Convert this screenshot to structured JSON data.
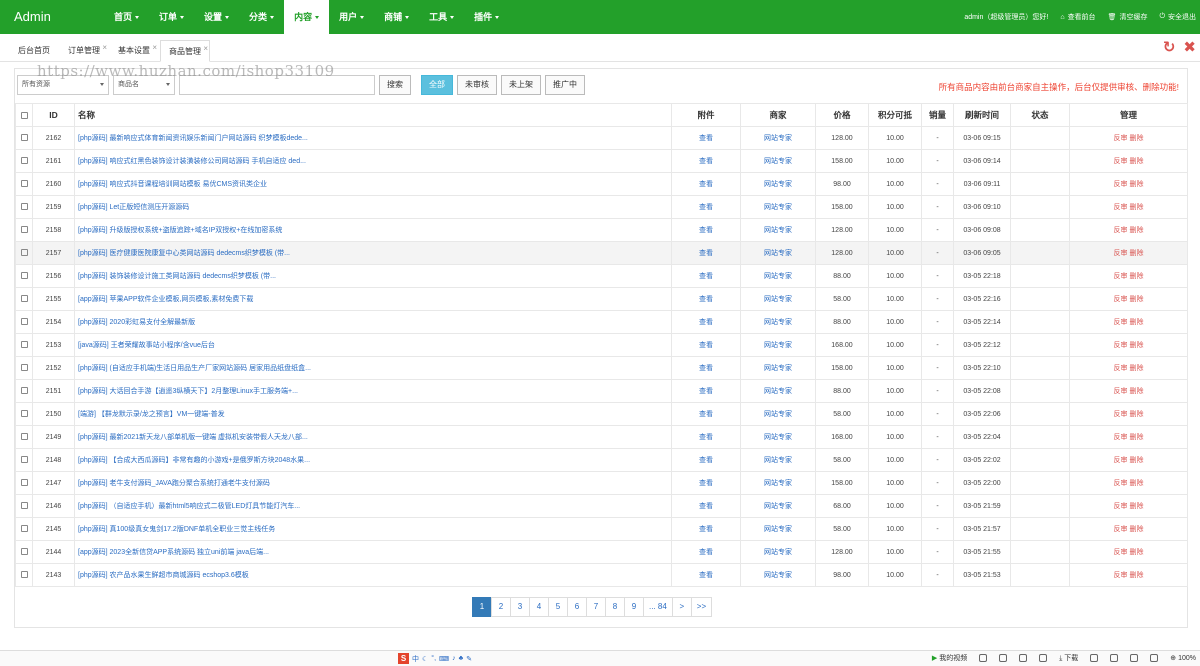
{
  "brand": "Admin",
  "nav": [
    {
      "label": "首页",
      "active": false
    },
    {
      "label": "订单",
      "active": false
    },
    {
      "label": "设置",
      "active": false
    },
    {
      "label": "分类",
      "active": false
    },
    {
      "label": "内容",
      "active": true
    },
    {
      "label": "用户",
      "active": false
    },
    {
      "label": "商铺",
      "active": false
    },
    {
      "label": "工具",
      "active": false
    },
    {
      "label": "插件",
      "active": false
    }
  ],
  "topright": {
    "user": "admin（超级管理员）您好!",
    "view_front": "查看前台",
    "clear_cache": "清空缓存",
    "logout": "安全退出"
  },
  "tabs": [
    {
      "label": "后台首页",
      "close": "",
      "active": false
    },
    {
      "label": "订单管理",
      "close": "×",
      "active": false
    },
    {
      "label": "基本设置",
      "close": "×",
      "active": false
    },
    {
      "label": "商品管理",
      "close": "×",
      "active": true
    }
  ],
  "tab_tools": {
    "refresh": "↻",
    "close": "✖"
  },
  "colors": {
    "brand": "#23a02a",
    "link": "#2a6cc2",
    "danger": "#e43",
    "info": "#5bc0de",
    "pager": "#337ab7"
  },
  "watermark": "https://www.huzhan.com/ishop33109",
  "filters": {
    "source": "所有资源",
    "field": "商品名",
    "search": "搜索",
    "btn_all": "全部",
    "btn_unreviewed": "未审核",
    "btn_offline": "未上架",
    "btn_promoting": "推广中"
  },
  "notice": "所有商品内容由前台商家自主操作，后台仅提供审核、删除功能!",
  "columns": [
    "ID",
    "名称",
    "附件",
    "商家",
    "价格",
    "积分可抵",
    "销量",
    "刷新时间",
    "状态",
    "管理"
  ],
  "rows": [
    {
      "id": "2162",
      "name": "[php源码] 最新响应式体育新闻资讯娱乐新闻门户网站源码 织梦模板dede...",
      "attach": "查看",
      "merchant": "网站专家",
      "price": "128.00",
      "points": "10.00",
      "sales": "-",
      "time": "03-06 09:15",
      "status": "",
      "unreview": "反审",
      "del": "删除"
    },
    {
      "id": "2161",
      "name": "[php源码] 响应式红黑色装饰设计装潢装修公司网站源码 手机自适应 ded...",
      "attach": "查看",
      "merchant": "网站专家",
      "price": "158.00",
      "points": "10.00",
      "sales": "-",
      "time": "03-06 09:14",
      "status": "",
      "unreview": "反审",
      "del": "删除"
    },
    {
      "id": "2160",
      "name": "[php源码] 响应式抖音课程培训网站模板 易优CMS资讯类企业",
      "attach": "查看",
      "merchant": "网站专家",
      "price": "98.00",
      "points": "10.00",
      "sales": "-",
      "time": "03-06 09:11",
      "status": "",
      "unreview": "反审",
      "del": "删除"
    },
    {
      "id": "2159",
      "name": "[php源码] Let正版短信测压开源源码",
      "attach": "查看",
      "merchant": "网站专家",
      "price": "158.00",
      "points": "10.00",
      "sales": "-",
      "time": "03-06 09:10",
      "status": "",
      "unreview": "反审",
      "del": "删除"
    },
    {
      "id": "2158",
      "name": "[php源码] 升级版授权系统+盗版追踪+域名IP双授权+在线加密系统",
      "attach": "查看",
      "merchant": "网站专家",
      "price": "128.00",
      "points": "10.00",
      "sales": "-",
      "time": "03-06 09:08",
      "status": "",
      "unreview": "反审",
      "del": "删除"
    },
    {
      "id": "2157",
      "name": "[php源码] 医疗健康医院康复中心类网站源码 dedecms织梦模板 (带...",
      "attach": "查看",
      "merchant": "网站专家",
      "price": "128.00",
      "points": "10.00",
      "sales": "-",
      "time": "03-06 09:05",
      "status": "",
      "unreview": "反审",
      "del": "删除",
      "hl": true
    },
    {
      "id": "2156",
      "name": "[php源码] 装饰装修设计施工类网站源码 dedecms织梦模板 (带...",
      "attach": "查看",
      "merchant": "网站专家",
      "price": "88.00",
      "points": "10.00",
      "sales": "-",
      "time": "03-05 22:18",
      "status": "",
      "unreview": "反审",
      "del": "删除"
    },
    {
      "id": "2155",
      "name": "[app源码] 苹果APP软件企业模板,网页模板,素材免费下载",
      "attach": "查看",
      "merchant": "网站专家",
      "price": "58.00",
      "points": "10.00",
      "sales": "-",
      "time": "03-05 22:16",
      "status": "",
      "unreview": "反审",
      "del": "删除"
    },
    {
      "id": "2154",
      "name": "[php源码] 2020彩虹易支付全解最新版",
      "attach": "查看",
      "merchant": "网站专家",
      "price": "88.00",
      "points": "10.00",
      "sales": "-",
      "time": "03-05 22:14",
      "status": "",
      "unreview": "反审",
      "del": "删除"
    },
    {
      "id": "2153",
      "name": "[java源码] 王者荣耀故事站小程序/含vue后台",
      "attach": "查看",
      "merchant": "网站专家",
      "price": "168.00",
      "points": "10.00",
      "sales": "-",
      "time": "03-05 22:12",
      "status": "",
      "unreview": "反审",
      "del": "删除"
    },
    {
      "id": "2152",
      "name": "[php源码] (自适应手机端)生活日用品生产厂家网站源码 居家用品纸盘纸盒...",
      "attach": "查看",
      "merchant": "网站专家",
      "price": "158.00",
      "points": "10.00",
      "sales": "-",
      "time": "03-05 22:10",
      "status": "",
      "unreview": "反审",
      "del": "删除"
    },
    {
      "id": "2151",
      "name": "[php源码] 大话回合手游【逍遥3纵横天下】2月整理Linux手工服务端+...",
      "attach": "查看",
      "merchant": "网站专家",
      "price": "88.00",
      "points": "10.00",
      "sales": "-",
      "time": "03-05 22:08",
      "status": "",
      "unreview": "反审",
      "del": "删除"
    },
    {
      "id": "2150",
      "name": "[端游] 【群龙默示录/龙之预言】VM一键端-普发",
      "attach": "查看",
      "merchant": "网站专家",
      "price": "58.00",
      "points": "10.00",
      "sales": "-",
      "time": "03-05 22:06",
      "status": "",
      "unreview": "反审",
      "del": "删除"
    },
    {
      "id": "2149",
      "name": "[php源码] 最新2021新天龙八部单机版一键端 虚拟机安装带假人天龙八部...",
      "attach": "查看",
      "merchant": "网站专家",
      "price": "168.00",
      "points": "10.00",
      "sales": "-",
      "time": "03-05 22:04",
      "status": "",
      "unreview": "反审",
      "del": "删除"
    },
    {
      "id": "2148",
      "name": "[php源码] 【合成大西瓜源码】非常有趣的小游戏+是俄罗斯方块2048水果...",
      "attach": "查看",
      "merchant": "网站专家",
      "price": "58.00",
      "points": "10.00",
      "sales": "-",
      "time": "03-05 22:02",
      "status": "",
      "unreview": "反审",
      "del": "删除"
    },
    {
      "id": "2147",
      "name": "[php源码] 老牛支付源码_JAVA跑分聚合系统打通老牛支付源码",
      "attach": "查看",
      "merchant": "网站专家",
      "price": "158.00",
      "points": "10.00",
      "sales": "-",
      "time": "03-05 22:00",
      "status": "",
      "unreview": "反审",
      "del": "删除"
    },
    {
      "id": "2146",
      "name": "[php源码] （自适应手机）最新html5响应式二极管LED灯具节能灯汽车...",
      "attach": "查看",
      "merchant": "网站专家",
      "price": "68.00",
      "points": "10.00",
      "sales": "-",
      "time": "03-05 21:59",
      "status": "",
      "unreview": "反审",
      "del": "删除"
    },
    {
      "id": "2145",
      "name": "[php源码] 真100级真女鬼剑17.2版DNF单机全职业三觉主线任务",
      "attach": "查看",
      "merchant": "网站专家",
      "price": "58.00",
      "points": "10.00",
      "sales": "-",
      "time": "03-05 21:57",
      "status": "",
      "unreview": "反审",
      "del": "删除"
    },
    {
      "id": "2144",
      "name": "[app源码] 2023全新信贷APP系统源码 独立uni前端 java后端...",
      "attach": "查看",
      "merchant": "网站专家",
      "price": "128.00",
      "points": "10.00",
      "sales": "-",
      "time": "03-05 21:55",
      "status": "",
      "unreview": "反审",
      "del": "删除"
    },
    {
      "id": "2143",
      "name": "[php源码] 农产品水果生鲜超市商城源码 ecshop3.6模板",
      "attach": "查看",
      "merchant": "网站专家",
      "price": "98.00",
      "points": "10.00",
      "sales": "-",
      "time": "03-05 21:53",
      "status": "",
      "unreview": "反审",
      "del": "删除"
    }
  ],
  "pager": [
    {
      "label": "1",
      "cur": true
    },
    {
      "label": "2"
    },
    {
      "label": "3"
    },
    {
      "label": "4"
    },
    {
      "label": "5"
    },
    {
      "label": "6"
    },
    {
      "label": "7"
    },
    {
      "label": "8"
    },
    {
      "label": "9"
    },
    {
      "label": "... 84"
    },
    {
      "label": ">"
    },
    {
      "label": ">>"
    }
  ],
  "statusbar": {
    "ime_s": "S",
    "ime_lang": "中",
    "my_video": "我的视频",
    "download": "下载",
    "zoom": "100%"
  }
}
